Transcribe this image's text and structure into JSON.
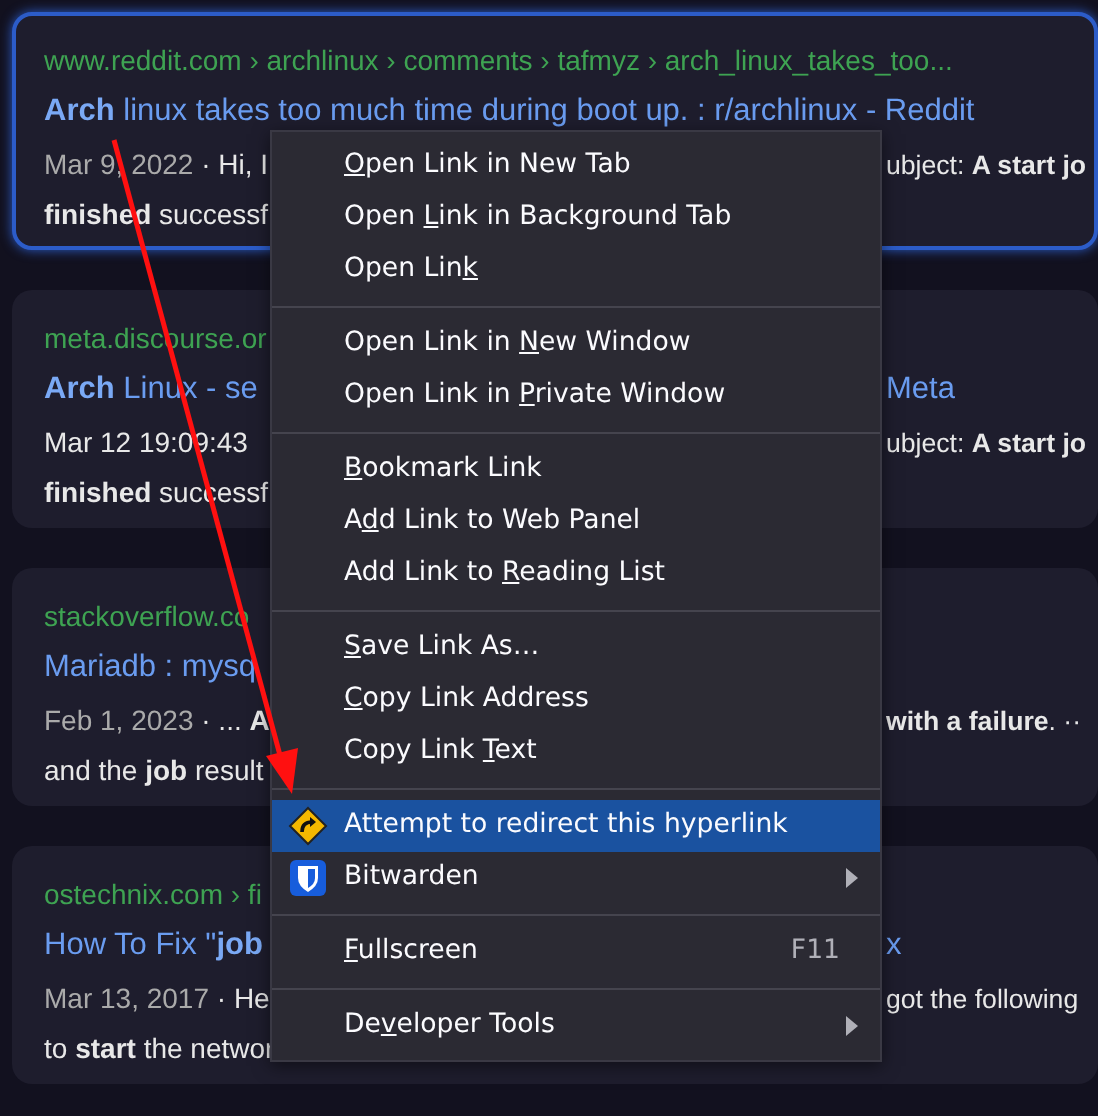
{
  "results": [
    {
      "focused": true,
      "url": "www.reddit.com › archlinux › comments › tafmyz › arch_linux_takes_too...",
      "title": {
        "left": "**Arch** linux takes too much time during boot up. : r/archlinux - Reddit"
      },
      "snippet": [
        {
          "date": "Mar 9, 2022",
          "left": " · Hi, I",
          "right": "ubject: **A start jo**"
        },
        {
          "left": "**finished** successf"
        }
      ]
    },
    {
      "focused": false,
      "url": "meta.discourse.or",
      "title": {
        "left": "**Arch** Linux - se",
        "right": "Meta"
      },
      "snippet": [
        {
          "left": "Mar 12 19:09:43",
          "right": "ubject: **A start jo**"
        },
        {
          "left": "**finished** successf"
        }
      ]
    },
    {
      "focused": false,
      "url": "stackoverflow.co",
      "title": {
        "left": "Mariadb : mysq"
      },
      "snippet": [
        {
          "date": "Feb 1, 2023",
          "left": " · ... **A**",
          "right": "**with a failure**. ··"
        },
        {
          "left": "and the **job** result"
        }
      ]
    },
    {
      "focused": false,
      "url": "ostechnix.com › fi",
      "title": {
        "left": "How To Fix \"**job**",
        "right": "x"
      },
      "snippet": [
        {
          "date": "Mar 13, 2017",
          "left": " · He",
          "right": "got the following"
        },
        {
          "left": "to **start** the networ"
        }
      ]
    }
  ],
  "context_menu": [
    {
      "kind": "item",
      "key": "O",
      "post": "pen Link in New Tab",
      "selected": false
    },
    {
      "kind": "item",
      "pre": "Open ",
      "key": "L",
      "post": "ink in Background Tab",
      "selected": false
    },
    {
      "kind": "item",
      "pre": "Open Lin",
      "key": "k",
      "selected": false
    },
    {
      "kind": "separator"
    },
    {
      "kind": "item",
      "pre": "Open Link in ",
      "key": "N",
      "post": "ew Window",
      "selected": false
    },
    {
      "kind": "item",
      "pre": "Open Link in ",
      "key": "P",
      "post": "rivate Window",
      "selected": false
    },
    {
      "kind": "separator"
    },
    {
      "kind": "item",
      "key": "B",
      "post": "ookmark Link",
      "selected": false
    },
    {
      "kind": "item",
      "pre": "A",
      "key": "d",
      "post": "d Link to Web Panel",
      "selected": false
    },
    {
      "kind": "item",
      "pre": "Add Link to ",
      "key": "R",
      "post": "eading List",
      "selected": false
    },
    {
      "kind": "separator"
    },
    {
      "kind": "item",
      "key": "S",
      "post": "ave Link As…",
      "selected": false
    },
    {
      "kind": "item",
      "key": "C",
      "post": "opy Link Address",
      "selected": false
    },
    {
      "kind": "item",
      "pre": "Copy Link ",
      "key": "T",
      "post": "ext",
      "selected": false
    },
    {
      "kind": "separator"
    },
    {
      "kind": "redirect",
      "pre": "Attempt to redirect this hyperlink",
      "selected": true
    },
    {
      "kind": "shield",
      "pre": "Bitwarden",
      "submenu": true,
      "selected": false
    },
    {
      "kind": "separator"
    },
    {
      "kind": "item",
      "key": "F",
      "post": "ullscreen",
      "shortcut": "F11",
      "selected": false
    },
    {
      "kind": "separator"
    },
    {
      "kind": "item",
      "pre": "De",
      "key": "v",
      "post": "eloper Tools",
      "submenu": true,
      "selected": false
    }
  ]
}
